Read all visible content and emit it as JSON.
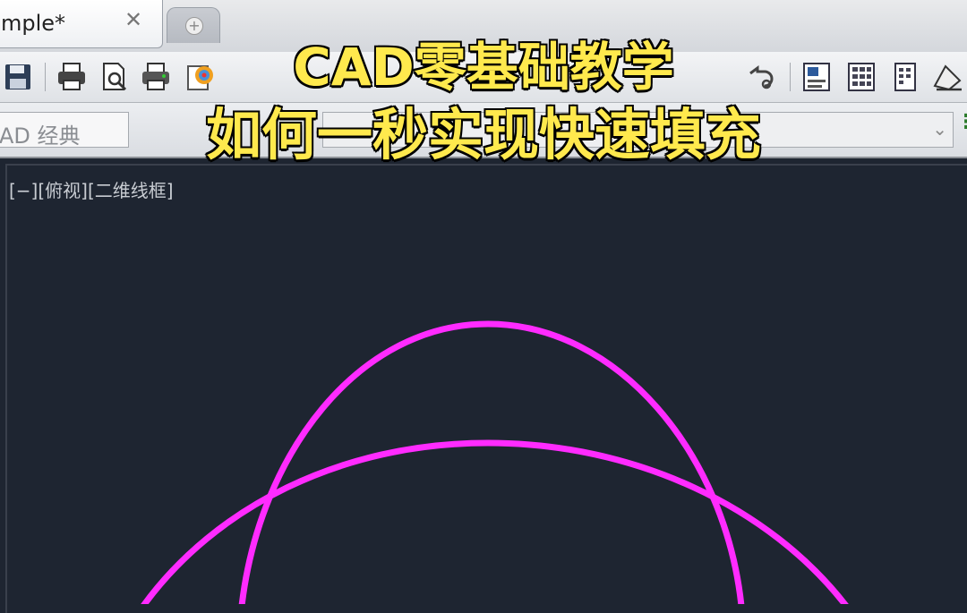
{
  "tabs": {
    "active_label": "mple*",
    "close_glyph": "✕",
    "new_tab_glyph": "+"
  },
  "toolbar": {
    "icons": [
      "save-icon",
      "print-icon",
      "print-preview-icon",
      "plot-icon",
      "publish-icon",
      "undo-icon",
      "properties-icon",
      "design-center-icon",
      "tool-palettes-icon",
      "sheet-set-icon"
    ]
  },
  "workspace": {
    "selected": "AD 经典"
  },
  "viewport": {
    "label": "[−][俯视][二维线框]"
  },
  "overlay": {
    "line1": "CAD零基础教学",
    "line2": "如何一秒实现快速填充"
  },
  "colors": {
    "canvas_bg": "#1e2531",
    "curve": "#ff2bff",
    "overlay_text": "#ffe94d"
  }
}
